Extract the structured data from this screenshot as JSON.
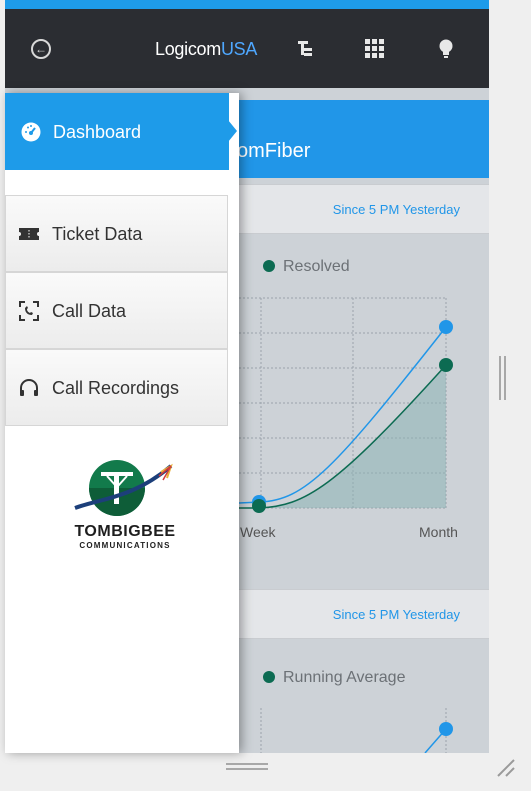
{
  "header": {
    "logo_main": "Logicom",
    "logo_accent": "USA",
    "icons": [
      "back-icon",
      "tree-icon",
      "grid-icon",
      "lightbulb-icon"
    ]
  },
  "drawer": {
    "items": [
      {
        "label": "Dashboard",
        "icon": "gauge-icon",
        "active": true
      },
      {
        "label": "Ticket Data",
        "icon": "ticket-icon",
        "active": false
      },
      {
        "label": "Call Data",
        "icon": "phone-frame-icon",
        "active": false
      },
      {
        "label": "Call Recordings",
        "icon": "headphones-icon",
        "active": false
      }
    ],
    "company": {
      "name": "TOMBIGBEE",
      "sub": "COMMUNICATIONS"
    }
  },
  "main": {
    "banner_title": "omFiber",
    "cards": [
      {
        "since": "Since 5 PM Yesterday",
        "legend": "Resolved",
        "x_labels": [
          "Week",
          "Month"
        ]
      },
      {
        "since": "Since 5 PM Yesterday",
        "legend": "Running Average"
      }
    ]
  },
  "colors": {
    "accent": "#1e9be9",
    "series_green": "#0c6b52",
    "header_bg": "#2b2d32"
  }
}
